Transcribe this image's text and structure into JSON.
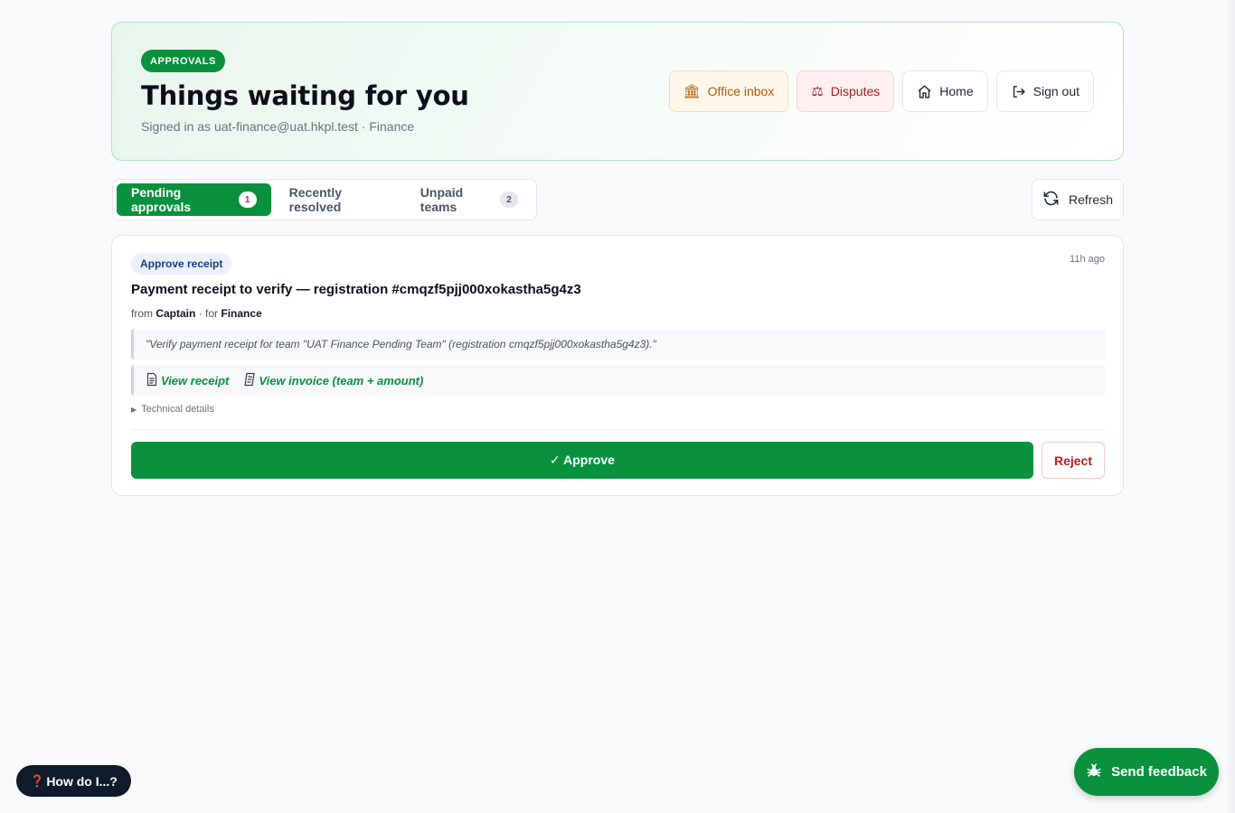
{
  "header": {
    "badge": "APPROVALS",
    "title": "Things waiting for you",
    "signed_in": "Signed in as uat-finance@uat.hkpl.test · Finance",
    "nav": [
      {
        "label": "Office inbox",
        "icon": "bank-icon"
      },
      {
        "label": "Disputes",
        "icon": "scales-icon"
      },
      {
        "label": "Home",
        "icon": "home-icon"
      },
      {
        "label": "Sign out",
        "icon": "sign-out-icon"
      }
    ]
  },
  "tabs": [
    {
      "label": "Pending approvals",
      "count": "1",
      "active": true
    },
    {
      "label": "Recently resolved",
      "count": null,
      "active": false
    },
    {
      "label": "Unpaid teams",
      "count": "2",
      "active": false
    }
  ],
  "refresh_label": "Refresh",
  "approval": {
    "type": "Approve receipt",
    "time_ago": "11h ago",
    "title": "Payment receipt to verify — registration #cmqzf5pjj000xokastha5g4z3",
    "from_prefix": "from",
    "from": "Captain",
    "for_prefix": "· for",
    "for": "Finance",
    "quote": "\"Verify payment receipt for team \"UAT Finance Pending Team\" (registration cmqzf5pjj000xokastha5g4z3).\"",
    "links": [
      {
        "label": "View receipt",
        "icon": "document-icon"
      },
      {
        "label": "View invoice (team + amount)",
        "icon": "scroll-icon"
      }
    ],
    "technical_details": "Technical details",
    "approve_label": "✓ Approve",
    "reject_label": "Reject"
  },
  "help_button": {
    "icon": "❓",
    "label": "How do I...?"
  },
  "feedback_button": {
    "label": "Send feedback",
    "icon": "bug-icon"
  },
  "colors": {
    "brand_green": "#09913e",
    "reject_red": "#b91c1c",
    "dark_navy": "#0f1a2b"
  }
}
